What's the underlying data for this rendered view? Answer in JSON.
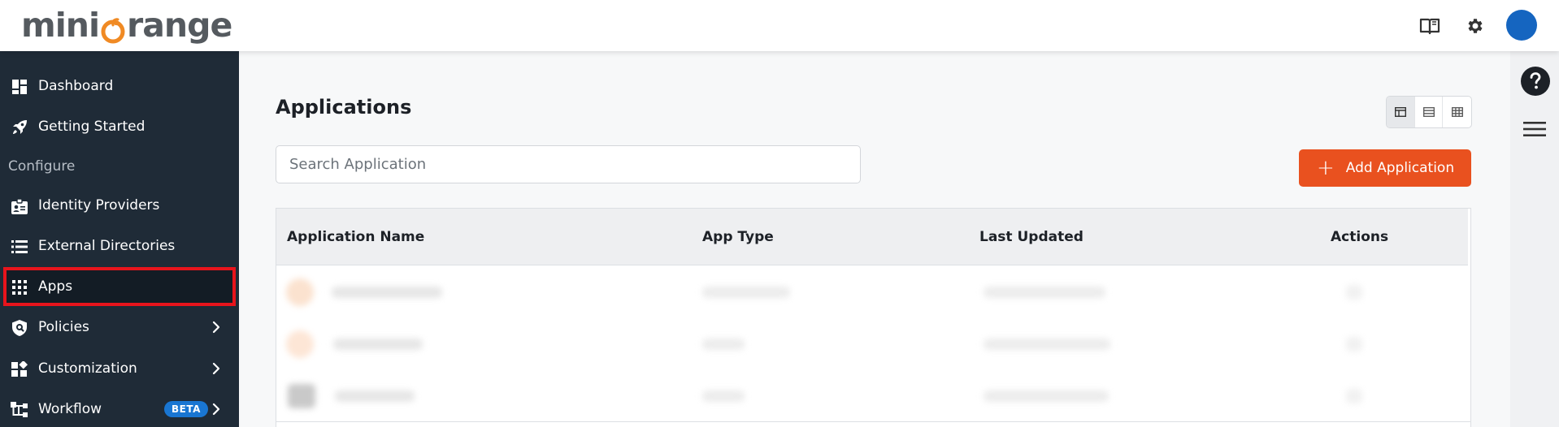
{
  "brand": {
    "logo_text_left": "mini",
    "logo_text_right": "range",
    "accent_color": "#f08a24"
  },
  "topbar": {
    "icons": [
      "book-icon",
      "gear-icon"
    ]
  },
  "sidebar": {
    "items": [
      {
        "label": "Dashboard",
        "icon": "dashboard-icon"
      },
      {
        "label": "Getting Started",
        "icon": "rocket-icon"
      }
    ],
    "section_label": "Configure",
    "config_items": [
      {
        "label": "Identity Providers",
        "icon": "id-badge-icon"
      },
      {
        "label": "External Directories",
        "icon": "list-icon"
      },
      {
        "label": "Apps",
        "icon": "grid-icon",
        "active": true
      },
      {
        "label": "Policies",
        "icon": "shield-icon",
        "has_submenu": true
      },
      {
        "label": "Customization",
        "icon": "widgets-icon",
        "has_submenu": true
      },
      {
        "label": "Workflow",
        "icon": "workflow-icon",
        "badge": "BETA",
        "has_submenu": true
      }
    ]
  },
  "main": {
    "title": "Applications",
    "search_placeholder": "Search Application",
    "add_button_label": "Add Application",
    "table": {
      "columns": [
        "Application Name",
        "App Type",
        "Last Updated",
        "Actions"
      ]
    }
  },
  "colors": {
    "sidebar_bg": "#1f2b37",
    "active_outline": "#e8141c",
    "primary_button": "#e9511f",
    "beta_badge": "#1976d2",
    "avatar": "#1565c0"
  }
}
